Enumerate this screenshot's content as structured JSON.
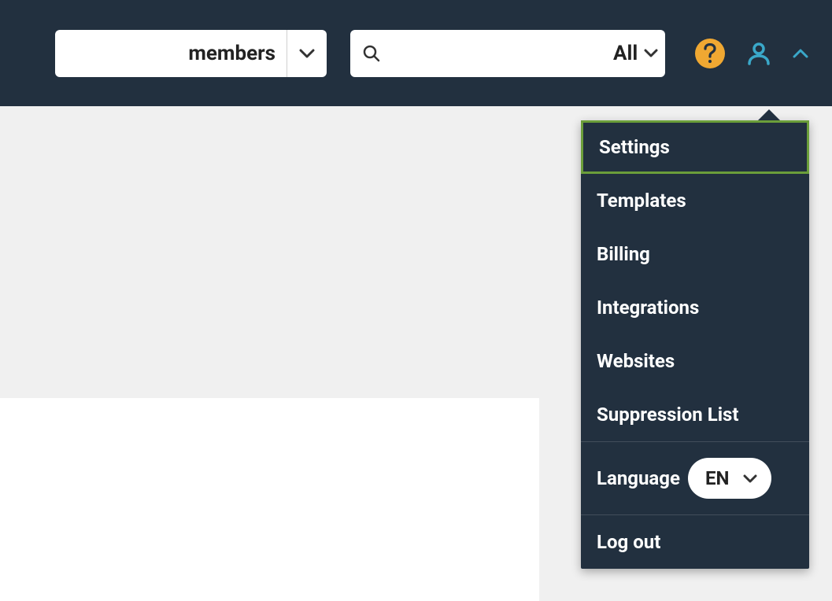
{
  "header": {
    "members_label": "members",
    "search_filter_label": "All"
  },
  "menu": {
    "items": [
      {
        "label": "Settings"
      },
      {
        "label": "Templates"
      },
      {
        "label": "Billing"
      },
      {
        "label": "Integrations"
      },
      {
        "label": "Websites"
      },
      {
        "label": "Suppression List"
      }
    ],
    "language_label": "Language",
    "language_value": "EN",
    "logout_label": "Log out"
  }
}
